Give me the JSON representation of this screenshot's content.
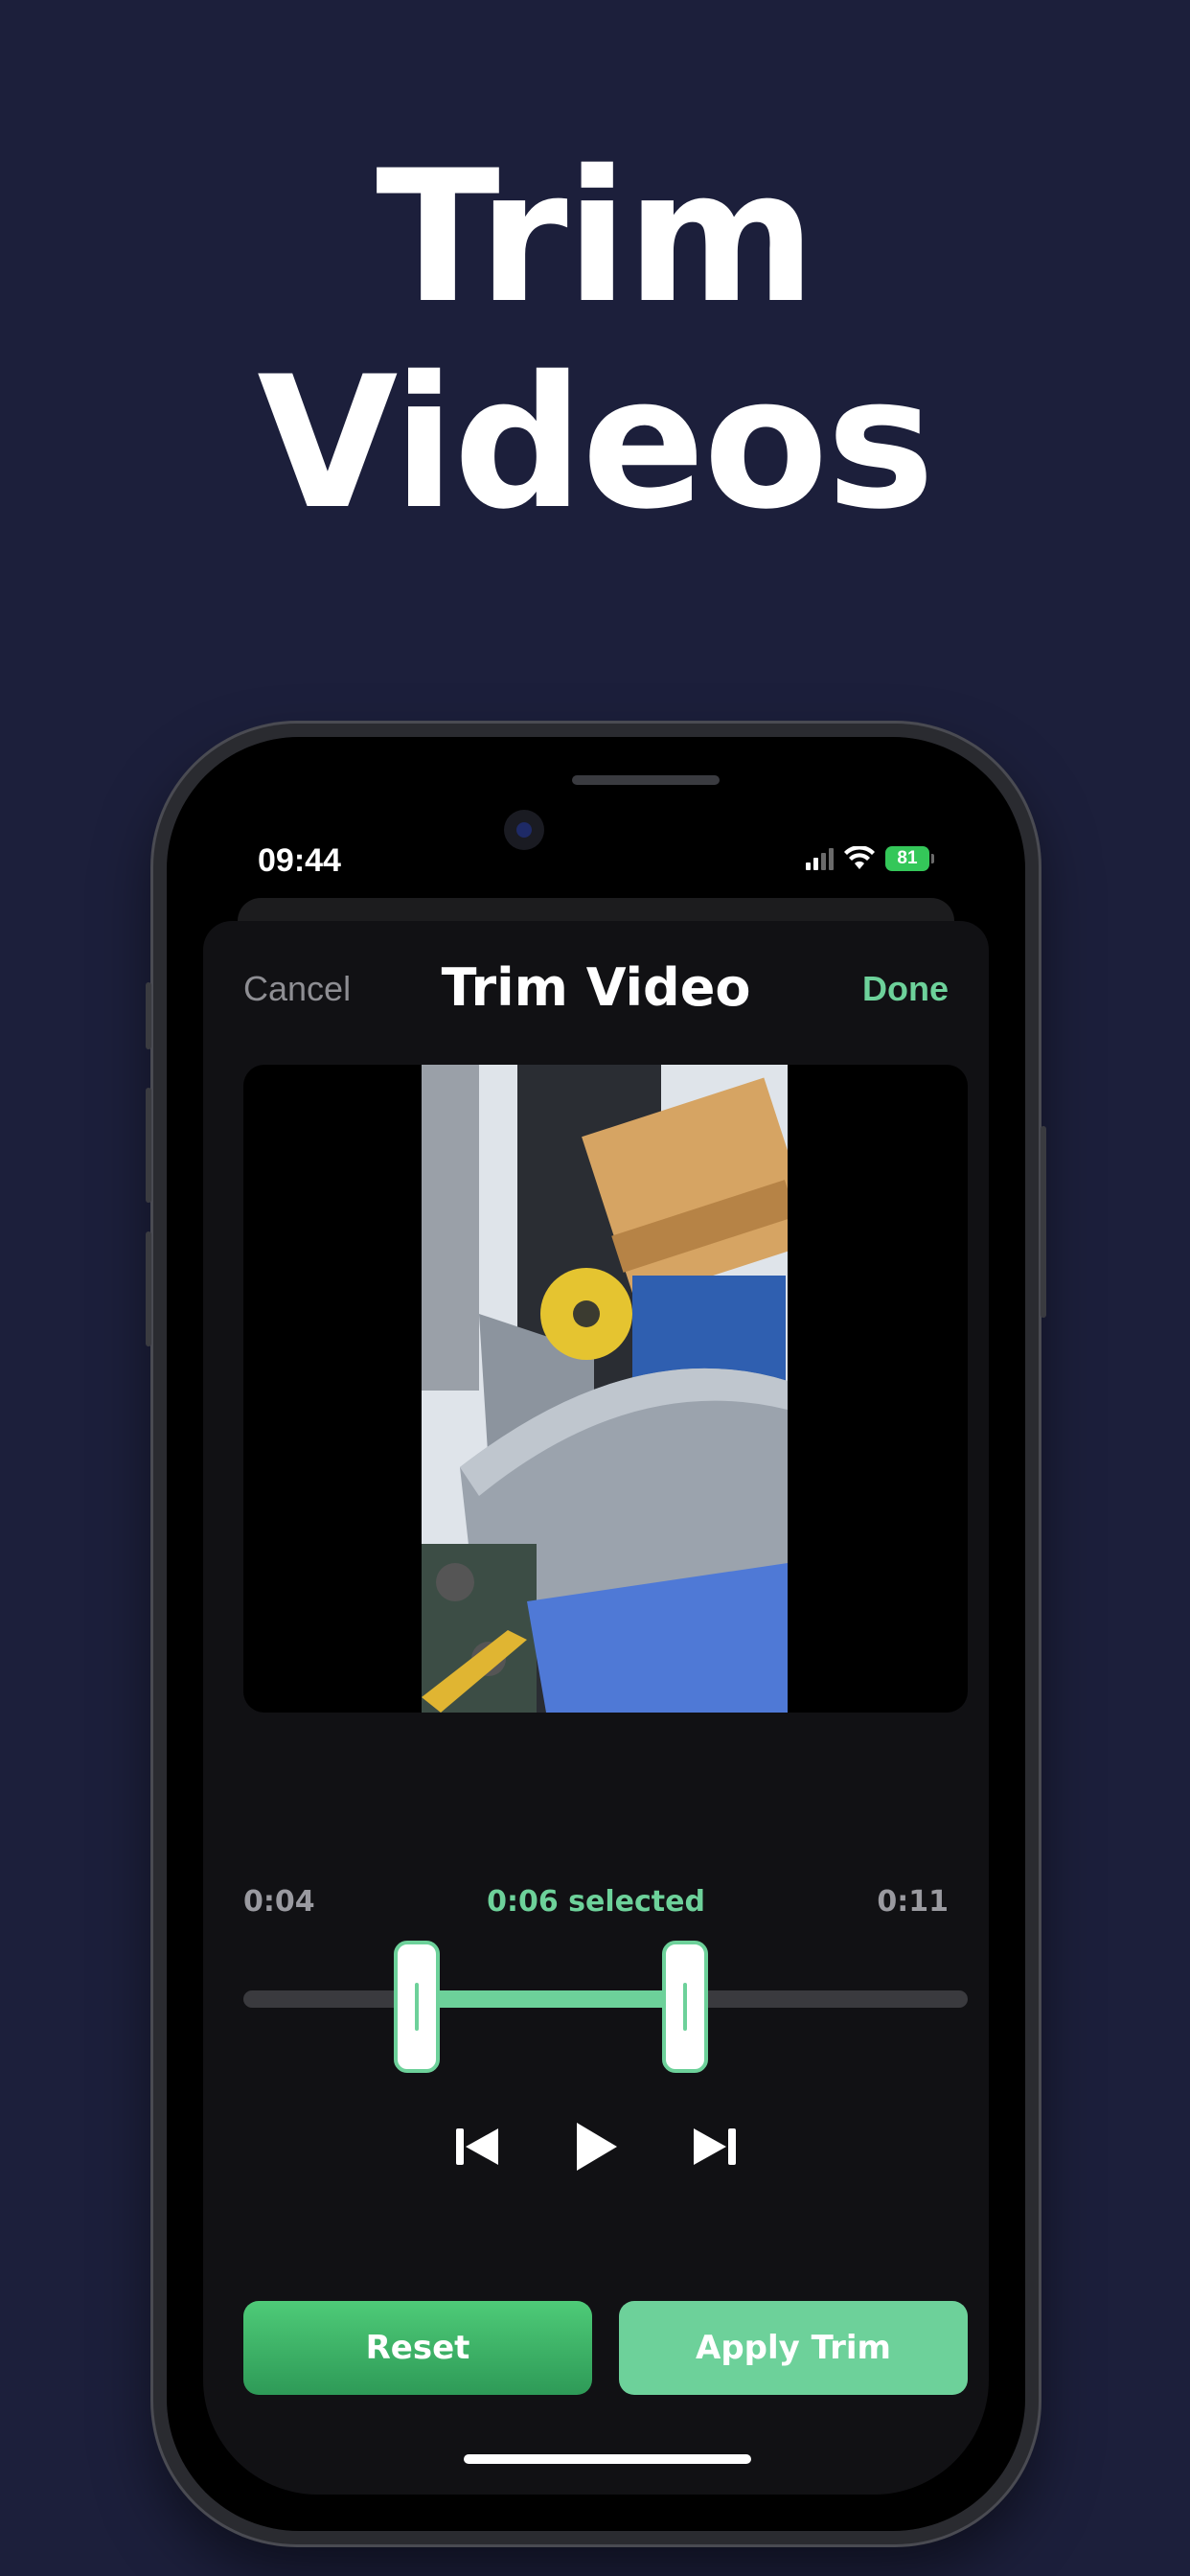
{
  "hero": {
    "line1": "Trim",
    "line2": "Videos"
  },
  "status_bar": {
    "time": "09:44",
    "battery": "81"
  },
  "nav": {
    "cancel": "Cancel",
    "title": "Trim Video",
    "done": "Done"
  },
  "trim": {
    "start_time": "0:04",
    "selected_label": "0:06 selected",
    "end_time": "0:11",
    "selection_start_fraction": 0.24,
    "selection_end_fraction": 0.61
  },
  "buttons": {
    "reset": "Reset",
    "apply": "Apply Trim"
  },
  "icons": {
    "skip_back": "skip-back-icon",
    "play": "play-icon",
    "skip_forward": "skip-forward-icon",
    "wifi": "wifi-icon",
    "signal": "signal-icon",
    "battery": "battery-icon"
  },
  "colors": {
    "background": "#1c1f3b",
    "accent": "#6dd19a",
    "reset_button": "#3fb468",
    "sheet": "#111114"
  }
}
